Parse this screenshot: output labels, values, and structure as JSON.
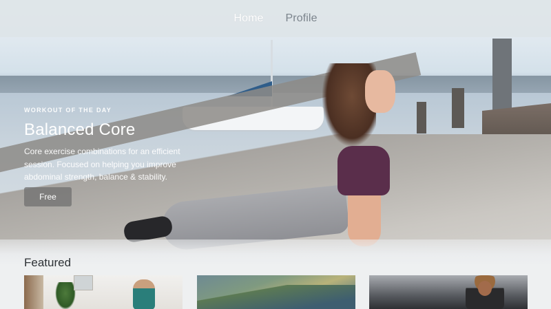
{
  "nav": {
    "items": [
      {
        "label": "Home",
        "active": true
      },
      {
        "label": "Profile",
        "active": false
      }
    ]
  },
  "hero": {
    "eyebrow": "WORKOUT OF THE DAY",
    "title": "Balanced Core",
    "description": "Core exercise combinations for an efficient session. Focused on helping you improve abdominal strength, balance & stability.",
    "button_label": "Free"
  },
  "featured": {
    "title": "Featured",
    "cards": [
      {
        "image": "yoga-studio-photo"
      },
      {
        "image": "landscape-photo"
      },
      {
        "image": "athlete-photo"
      }
    ]
  },
  "colors": {
    "nav_active": "#ffffff",
    "nav_inactive": "#7b848c",
    "button_bg": "#6e6e6e"
  }
}
